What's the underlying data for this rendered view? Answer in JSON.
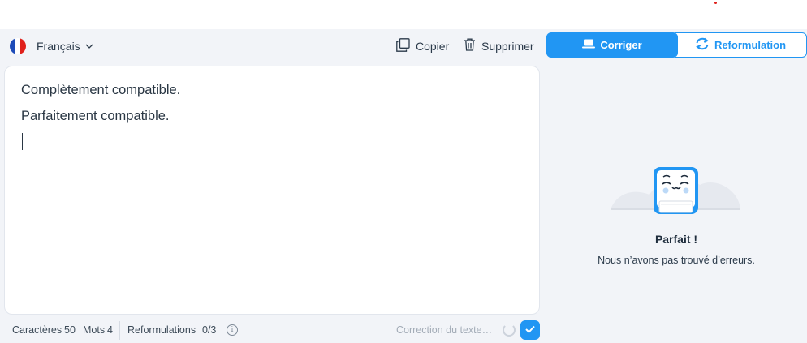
{
  "language": {
    "label": "Français",
    "flag_colors": [
      "#1d4bb8",
      "#ffffff",
      "#e0201b"
    ]
  },
  "toolbar": {
    "copy_label": "Copier",
    "delete_label": "Supprimer"
  },
  "modes": {
    "correct_label": "Corriger",
    "reformulate_label": "Reformulation",
    "active": "Corriger"
  },
  "editor": {
    "lines": [
      "Complètement compatible.",
      "Parfaitement compatible."
    ]
  },
  "footer": {
    "chars_label": "Caractères",
    "chars_value": "50",
    "words_label": "Mots",
    "words_value": "4",
    "reform_label": "Reformulations",
    "reform_value": "0/3",
    "status": "Correction du texte…"
  },
  "result": {
    "title": "Parfait !",
    "subtitle": "Nous n’avons pas trouvé d’erreurs."
  },
  "colors": {
    "accent": "#2196f3",
    "panel_bg": "#f2f4f8",
    "editor_bg": "#ffffff"
  },
  "icons": [
    "france-flag-icon",
    "chevron-down-icon",
    "copy-icon",
    "trash-icon",
    "laptop-icon",
    "refresh-icon",
    "info-icon",
    "spinner-icon",
    "check-icon",
    "robot-mascot-icon"
  ]
}
